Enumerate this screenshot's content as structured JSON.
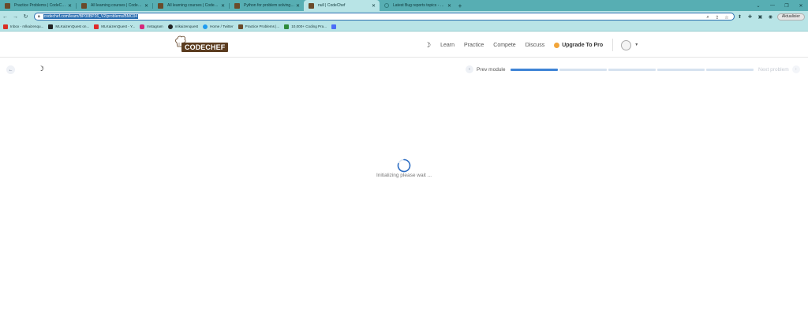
{
  "browser": {
    "tabs": [
      {
        "title": "Practice Problems | CodeChef",
        "active": false
      },
      {
        "title": "All learning courses | CodeChef",
        "active": false
      },
      {
        "title": "All learning courses | CodeChef",
        "active": false
      },
      {
        "title": "Python for problem solving - 2 |",
        "active": false
      },
      {
        "title": "null | CodeChef",
        "active": true
      },
      {
        "title": "Latest Bug reports topics - Codec",
        "active": false
      }
    ],
    "new_tab_glyph": "+",
    "window_controls": {
      "minimize": "⌄",
      "restore": "—",
      "maximize": "❐",
      "close": "✕"
    },
    "address": {
      "url": "codechef.com/learn/BP00BP26_V2/problems/BMC04"
    },
    "update_button": "Aktualisier"
  },
  "bookmarks": [
    {
      "label": "Inbox - mlkaizenqu...",
      "color": "#d93025"
    },
    {
      "label": "MLKaizenQuest on...",
      "color": "#222222"
    },
    {
      "label": "MLKaizenQuest - Y...",
      "color": "#e02a2a"
    },
    {
      "label": "Instagram",
      "color": "#d6287b"
    },
    {
      "label": "mlkaizenquest",
      "color": "#222222"
    },
    {
      "label": "Home / Twitter",
      "color": "#1d9bf0"
    },
    {
      "label": "Practice Problems |...",
      "color": "#6a4a2a"
    },
    {
      "label": "10,000+ Coding Pra...",
      "color": "#2e8b3a"
    },
    {
      "label": "",
      "color": "#4a6cf7"
    }
  ],
  "site": {
    "logo_text": "CODECHEF",
    "nav": {
      "learn": "Learn",
      "practice": "Practice",
      "compete": "Compete",
      "discuss": "Discuss"
    },
    "upgrade": "Upgrade To Pro"
  },
  "problem_bar": {
    "prev_label": "Prev module",
    "next_label": "Next problem",
    "progress_segments_total": 5,
    "progress_segments_done": 1
  },
  "loading": {
    "text": "Initializing please wait ..."
  },
  "colors": {
    "tabstrip": "#57aeb3",
    "toolbar": "#b8e4e6",
    "progress_done": "#3f84d6",
    "progress_todo": "#d6e2f0",
    "logo_brown": "#5b3c1f"
  }
}
